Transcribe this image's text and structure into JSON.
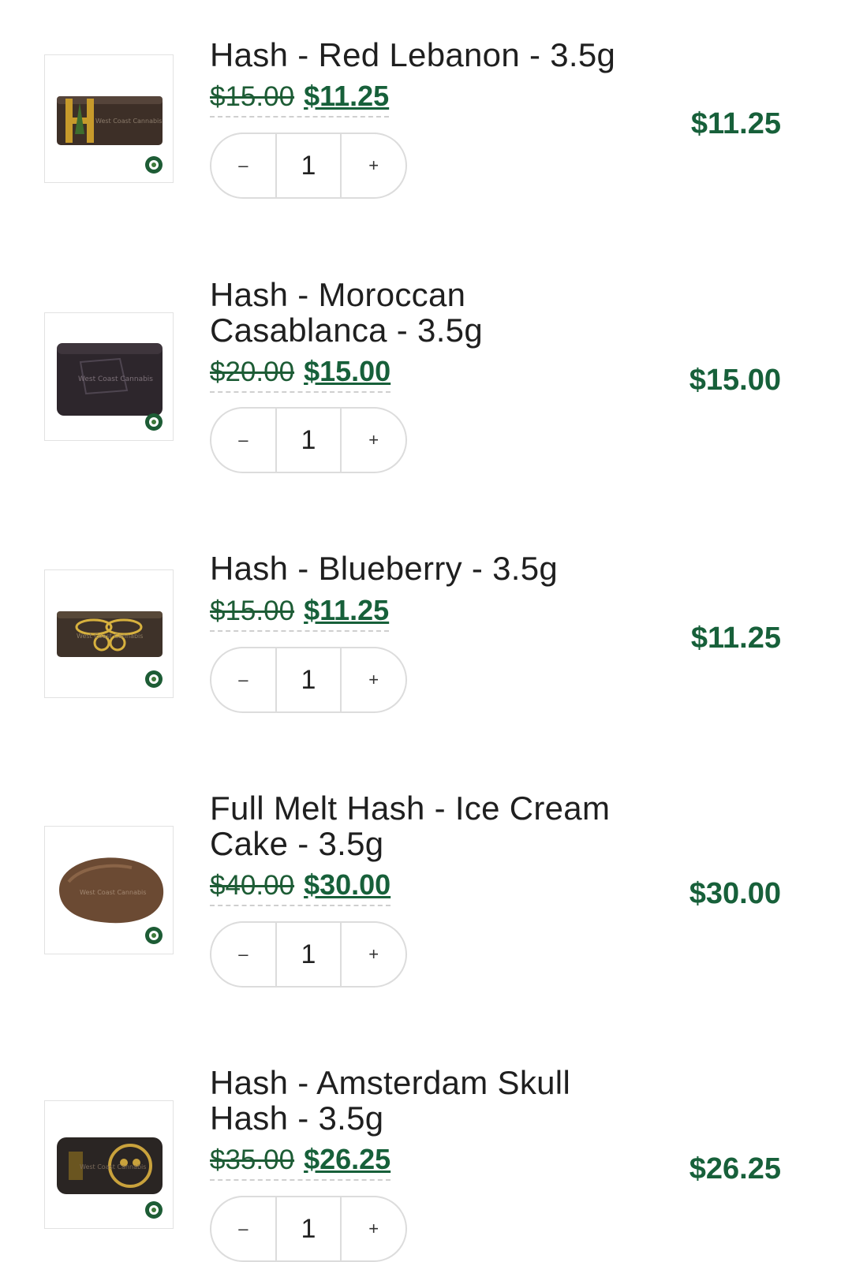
{
  "cart": {
    "items": [
      {
        "title": "Hash - Red Lebanon - 3.5g",
        "old_price": "$15.00",
        "new_price": "$11.25",
        "quantity": "1",
        "decrement": "–",
        "increment": "+",
        "line_total": "$11.25",
        "thumb_label": "West Coast Cannabis"
      },
      {
        "title": "Hash - Moroccan Casablanca - 3.5g",
        "old_price": "$20.00",
        "new_price": "$15.00",
        "quantity": "1",
        "decrement": "–",
        "increment": "+",
        "line_total": "$15.00",
        "thumb_label": "West Coast Cannabis"
      },
      {
        "title": "Hash - Blueberry - 3.5g",
        "old_price": "$15.00",
        "new_price": "$11.25",
        "quantity": "1",
        "decrement": "–",
        "increment": "+",
        "line_total": "$11.25",
        "thumb_label": "West Coast Cannabis"
      },
      {
        "title": "Full Melt Hash - Ice Cream Cake - 3.5g",
        "old_price": "$40.00",
        "new_price": "$30.00",
        "quantity": "1",
        "decrement": "–",
        "increment": "+",
        "line_total": "$30.00",
        "thumb_label": "West Coast Cannabis"
      },
      {
        "title": "Hash - Amsterdam Skull Hash - 3.5g",
        "old_price": "$35.00",
        "new_price": "$26.25",
        "quantity": "1",
        "decrement": "–",
        "increment": "+",
        "line_total": "$26.25",
        "thumb_label": "West Coast Cannabis"
      }
    ]
  },
  "colors": {
    "accent_green": "#17603a",
    "border": "#dcdcdc"
  }
}
